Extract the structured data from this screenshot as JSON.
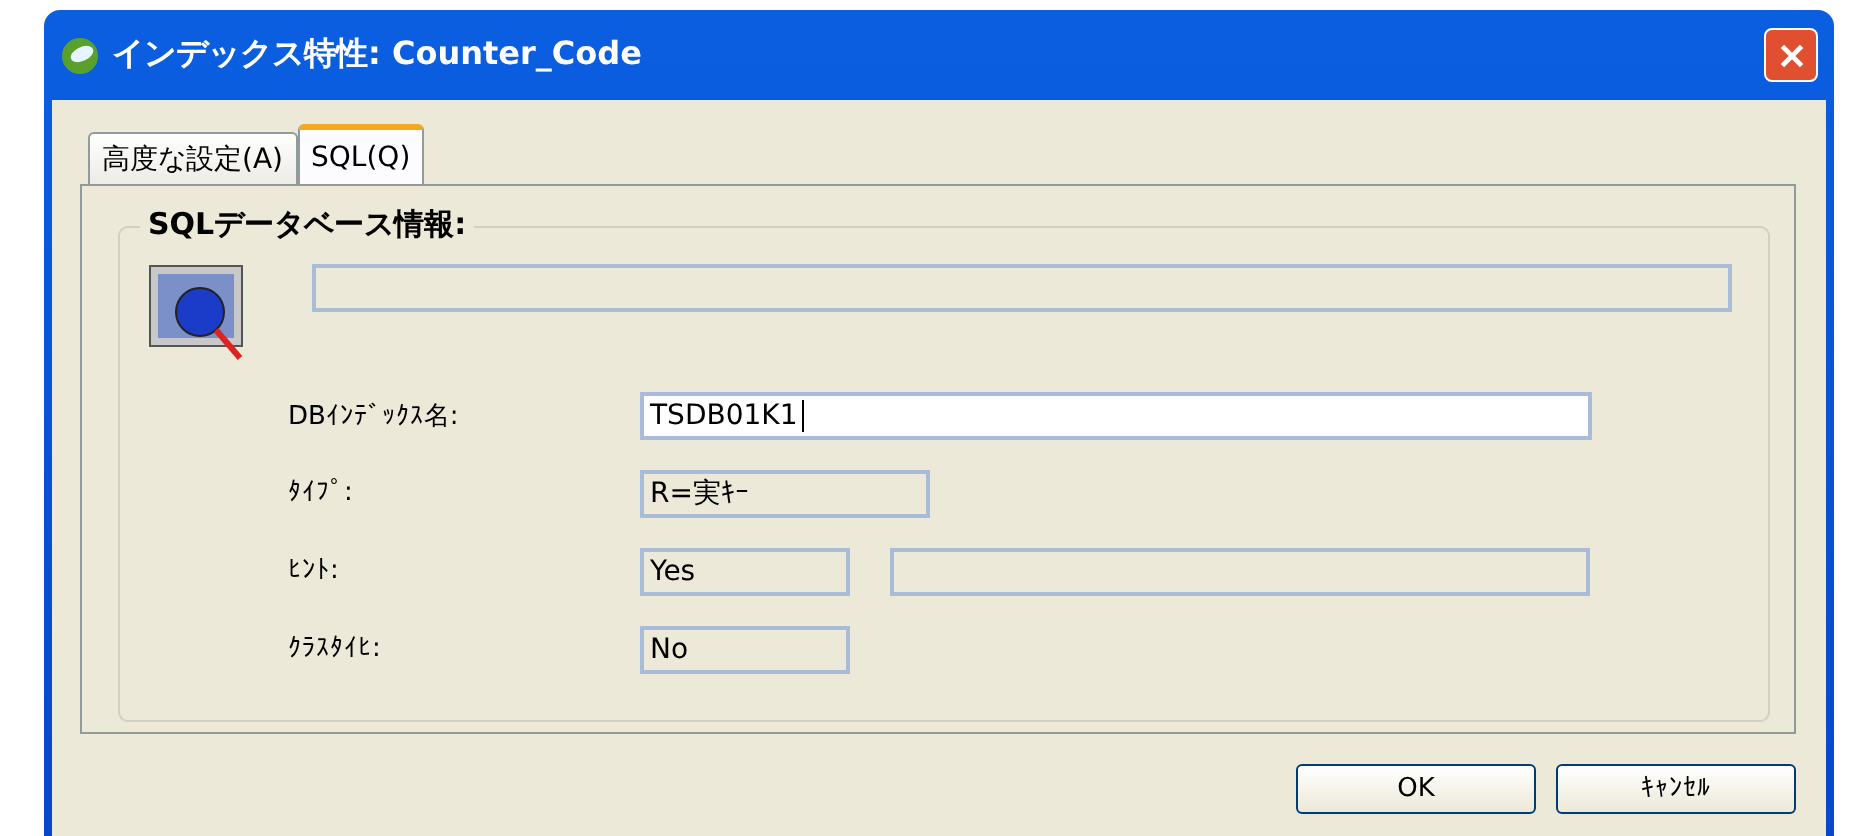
{
  "window": {
    "title": "インデックス特性: Counter_Code"
  },
  "tabs": [
    {
      "label": "高度な設定(A)",
      "selected": false
    },
    {
      "label": "SQL(Q)",
      "selected": true
    }
  ],
  "group": {
    "title": "SQLデータベース情報:",
    "description_field": {
      "readonly": true
    }
  },
  "fields": [
    {
      "label": "DBｲﾝﾃﾞｯｸｽ名:",
      "boxes": [
        {
          "value": "TSDB01K1",
          "readonly": false
        }
      ]
    },
    {
      "label": "ﾀｲﾌﾟ:",
      "boxes": [
        {
          "value": "R=実ｷｰ",
          "readonly": true
        }
      ]
    },
    {
      "label": "ﾋﾝﾄ:",
      "boxes": [
        {
          "value": "Yes",
          "readonly": true
        },
        {
          "readonly": true
        }
      ]
    },
    {
      "label": "ｸﾗｽﾀｲﾋ:",
      "boxes": [
        {
          "value": "No",
          "readonly": true
        }
      ]
    }
  ],
  "buttons": [
    "OK",
    "ｷｬﾝｾﾙ"
  ]
}
